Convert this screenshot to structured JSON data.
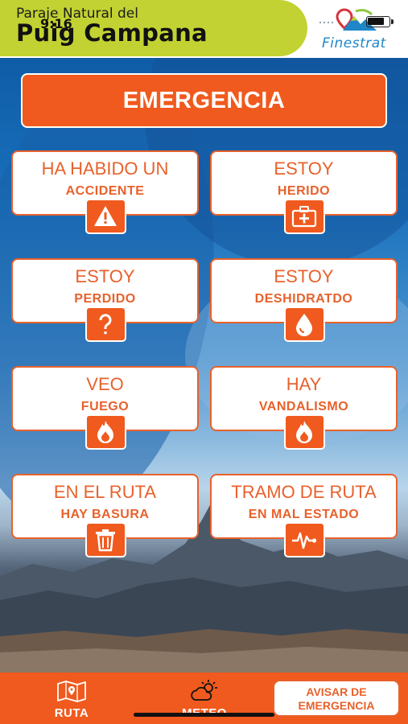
{
  "header": {
    "subtitle": "Paraje Natural del",
    "title": "Puig Campana",
    "status_time": "9:16",
    "logo_text": "Finestrat"
  },
  "banner": {
    "label": "EMERGENCIA"
  },
  "cards": [
    {
      "line1": "HA HABIDO UN",
      "line2": "ACCIDENTE",
      "icon": "warning-icon"
    },
    {
      "line1": "ESTOY",
      "line2": "HERIDO",
      "icon": "first-aid-kit-icon"
    },
    {
      "line1": "ESTOY",
      "line2": "PERDIDO",
      "icon": "question-mark-icon"
    },
    {
      "line1": "ESTOY",
      "line2": "DESHIDRATDO",
      "icon": "water-drop-icon"
    },
    {
      "line1": "VEO",
      "line2": "FUEGO",
      "icon": "fire-icon"
    },
    {
      "line1": "HAY",
      "line2": "VANDALISMO",
      "icon": "fire-icon"
    },
    {
      "line1": "EN EL RUTA",
      "line2": "HAY BASURA",
      "icon": "trash-icon"
    },
    {
      "line1": "TRAMO DE RUTA",
      "line2": "EN MAL ESTADO",
      "icon": "heartbeat-icon"
    }
  ],
  "nav": {
    "ruta_label": "RUTA",
    "meteo_label": "METEO",
    "alert_line1": "AVISAR DE",
    "alert_line2": "EMERGENCIA"
  },
  "colors": {
    "accent": "#f05a1e",
    "header_green": "#c2d232",
    "logo_blue": "#1f86c8"
  }
}
